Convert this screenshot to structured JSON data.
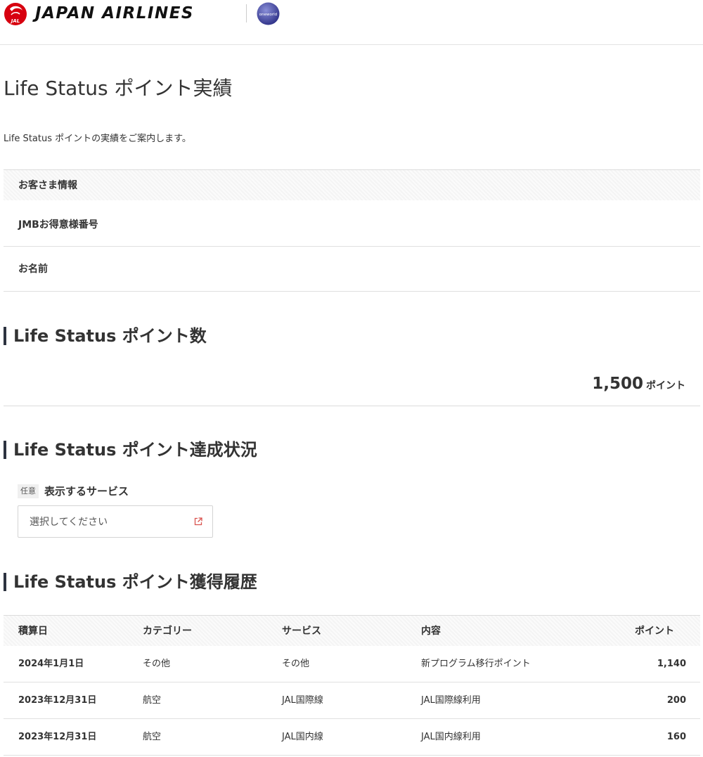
{
  "header": {
    "brand": "JAPAN AIRLINES",
    "jal_mark": "JAL",
    "alliance_mark": "oneworld"
  },
  "page": {
    "title": "Life Status ポイント実績",
    "description": "Life Status ポイントの実績をご案内します。"
  },
  "customer_info": {
    "heading": "お客さま情報",
    "member_number_label": "JMBお得意様番号",
    "name_label": "お名前"
  },
  "points": {
    "heading": "Life Status ポイント数",
    "value": "1,500",
    "unit": "ポイント"
  },
  "achievement": {
    "heading": "Life Status ポイント達成状況",
    "optional_badge": "任意",
    "filter_label": "表示するサービス",
    "select_placeholder": "選択してください"
  },
  "history": {
    "heading": "Life Status ポイント獲得履歴",
    "columns": [
      "積算日",
      "カテゴリー",
      "サービス",
      "内容",
      "ポイント"
    ],
    "rows": [
      {
        "date": "2024年1月1日",
        "category": "その他",
        "service": "その他",
        "description": "新プログラム移行ポイント",
        "points": "1,140"
      },
      {
        "date": "2023年12月31日",
        "category": "航空",
        "service": "JAL国際線",
        "description": "JAL国際線利用",
        "points": "200"
      },
      {
        "date": "2023年12月31日",
        "category": "航空",
        "service": "JAL国内線",
        "description": "JAL国内線利用",
        "points": "160"
      }
    ]
  },
  "colors": {
    "jal_red": "#d7000f",
    "oneworld_blue": "#3a3f9a",
    "heading_bar": "#2d3340",
    "external_link_icon": "#d9534f"
  }
}
